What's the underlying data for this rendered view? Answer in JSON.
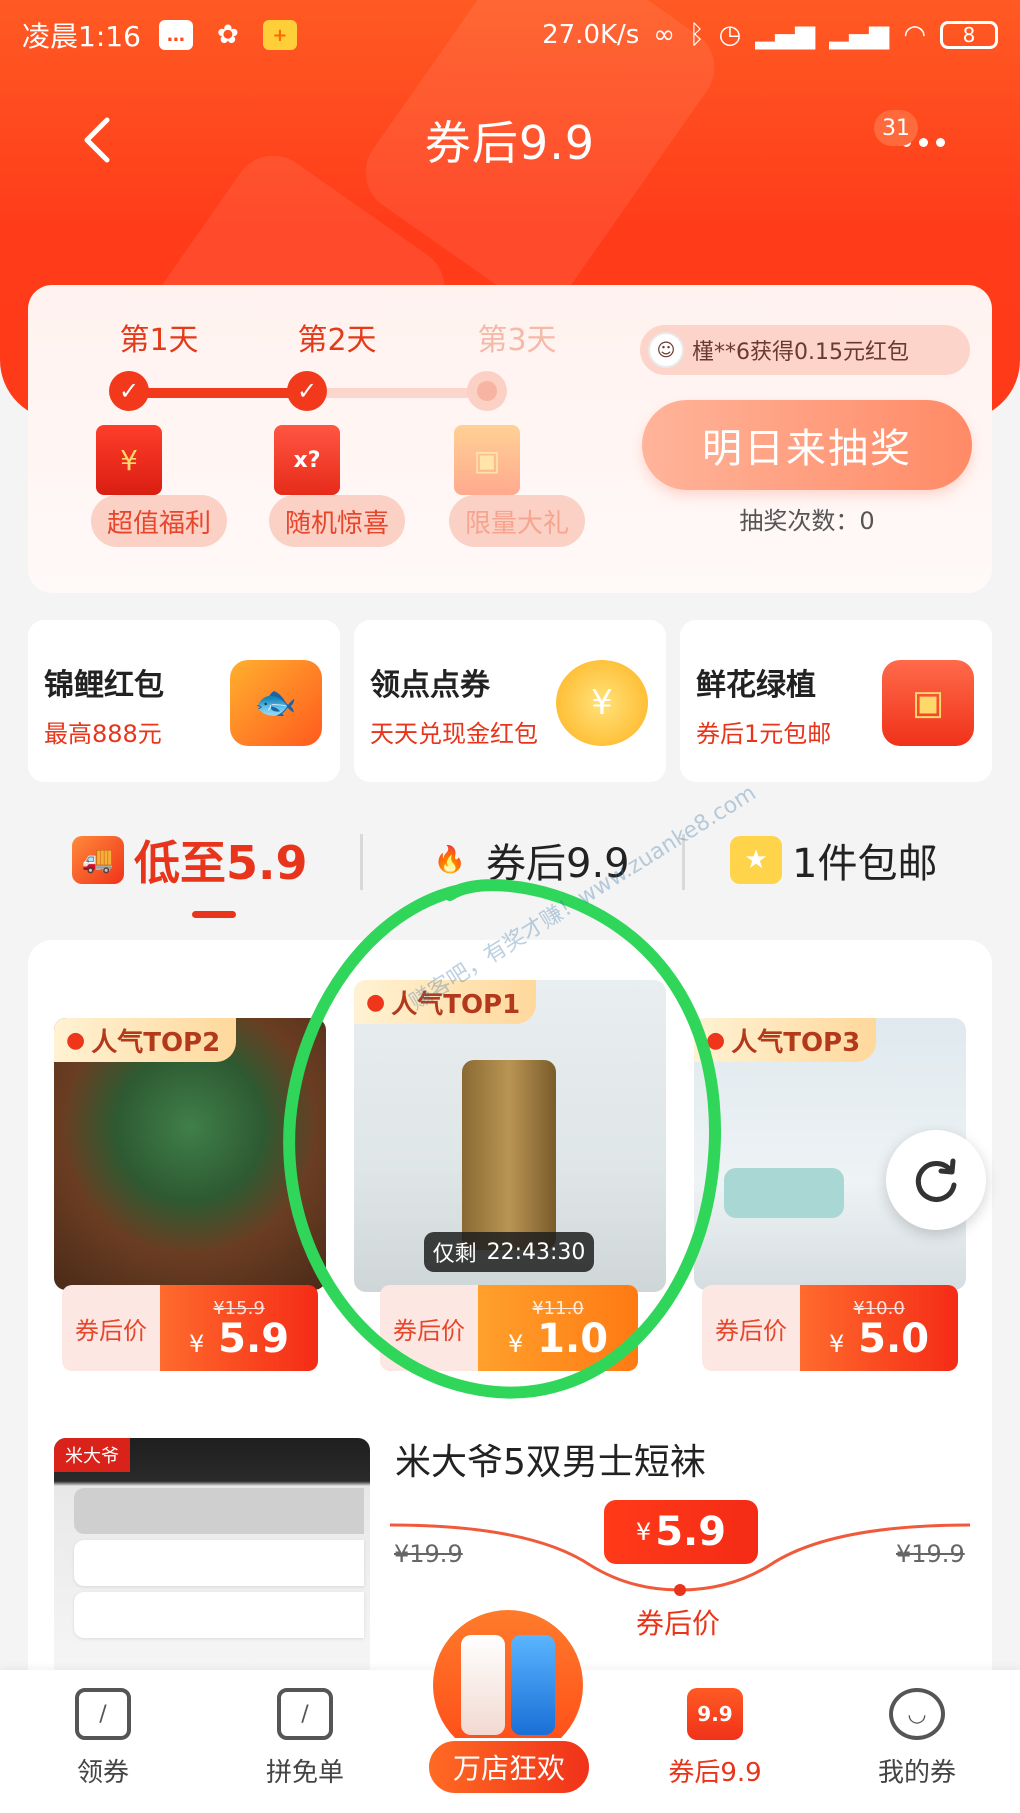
{
  "status_bar": {
    "time": "凌晨1:16",
    "net_speed": "27.0K/s",
    "battery": "8"
  },
  "nav": {
    "title": "券后9.9",
    "badge": "31"
  },
  "checkin": {
    "days": [
      {
        "label": "第1天",
        "reward": "超值福利",
        "done": true
      },
      {
        "label": "第2天",
        "reward": "随机惊喜",
        "done": true
      },
      {
        "label": "第3天",
        "reward": "限量大礼",
        "done": false
      }
    ],
    "winner_text": "槿**6获得0.15元红包",
    "lottery_button": "明日来抽奖",
    "lottery_count": "抽奖次数：0"
  },
  "promos": [
    {
      "title": "锦鲤红包",
      "subtitle": "最高888元"
    },
    {
      "title": "领点点券",
      "subtitle": "天天兑现金红包"
    },
    {
      "title": "鲜花绿植",
      "subtitle": "券后1元包邮"
    }
  ],
  "tabs": [
    {
      "label": "低至5.9",
      "active": true
    },
    {
      "label": "券后9.9",
      "active": false
    },
    {
      "label": "1件包邮",
      "active": false
    }
  ],
  "top_products": [
    {
      "rank": "人气TOP2",
      "coupon_label": "券后价",
      "original": "¥15.9",
      "currency": "¥",
      "price": "5.9"
    },
    {
      "rank": "人气TOP1",
      "coupon_label": "券后价",
      "original": "¥11.0",
      "currency": "¥",
      "price": "1.0"
    },
    {
      "rank": "人气TOP3",
      "coupon_label": "券后价",
      "original": "¥10.0",
      "currency": "¥",
      "price": "5.0"
    }
  ],
  "countdown": {
    "label": "仅剩",
    "time": "22:43:30"
  },
  "socks": {
    "brand": "米大爷",
    "title": "米大爷5双男士短袜",
    "original_left": "¥19.9",
    "original_right": "¥19.9",
    "currency": "¥",
    "price": "5.9",
    "price_label": "券后价"
  },
  "bottom_nav": [
    {
      "label": "领券",
      "active": false
    },
    {
      "label": "拼免单",
      "active": false
    },
    {
      "label": "万店狂欢",
      "active": false
    },
    {
      "label": "券后9.9",
      "active": true,
      "icon_text": "9.9"
    },
    {
      "label": "我的券",
      "active": false
    }
  ],
  "watermark": "赚客吧，有奖才赚！www.zuanke8.com"
}
